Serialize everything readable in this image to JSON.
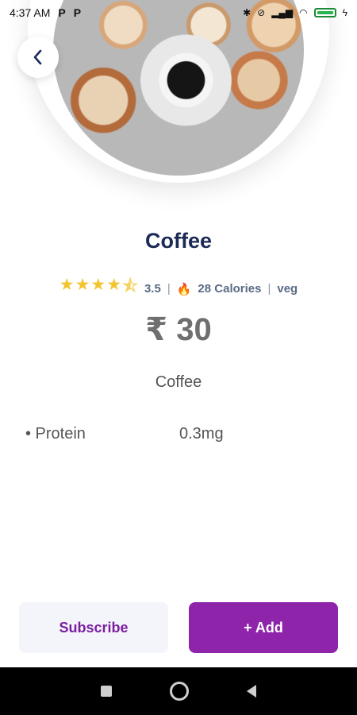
{
  "status_bar": {
    "time": "4:37 AM",
    "left_icons": [
      "P",
      "P"
    ],
    "right_icons": [
      "bluetooth-icon",
      "alarm-off-icon",
      "signal-icon",
      "wifi-icon",
      "battery-icon",
      "charging-icon"
    ]
  },
  "product": {
    "name": "Coffee",
    "rating": "3.5",
    "rating_stars": 4.5,
    "calories": "28 Calories",
    "diet": "veg",
    "price": "₹ 30",
    "description": "Coffee",
    "nutrients": [
      {
        "name": "• Protein",
        "value": "0.3mg"
      }
    ]
  },
  "actions": {
    "subscribe_label": "Subscribe",
    "add_label": "+ Add"
  },
  "colors": {
    "title": "#1b2a56",
    "accent": "#8e24aa",
    "star": "#f4c430"
  }
}
